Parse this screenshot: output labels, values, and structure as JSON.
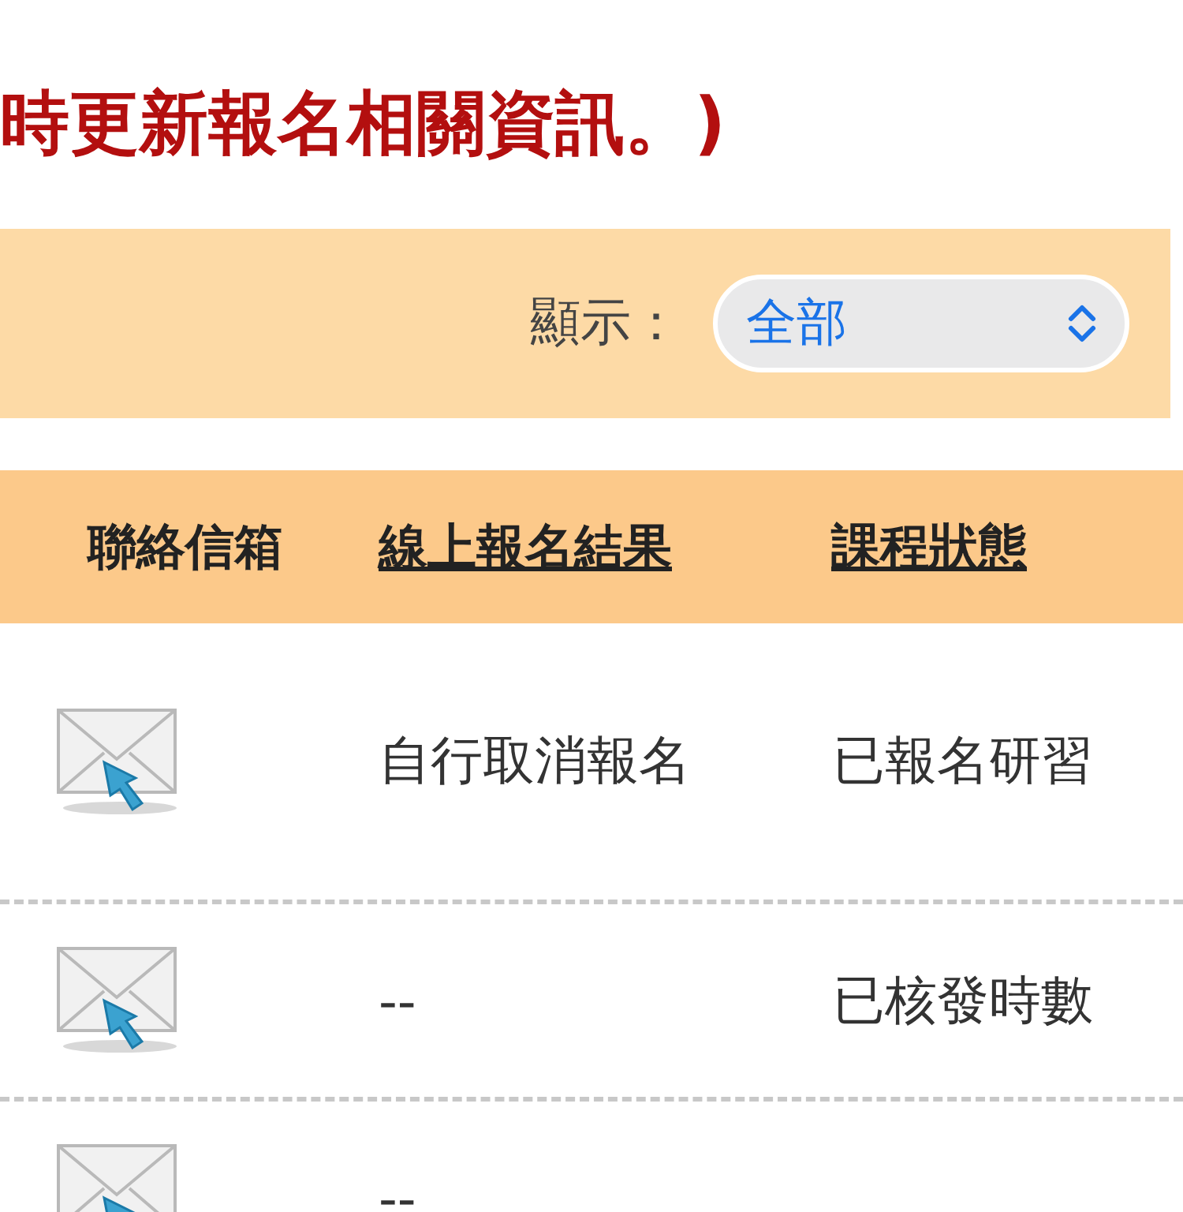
{
  "notice": "時更新報名相關資訊。)",
  "filter": {
    "label": "顯示：",
    "value": "全部"
  },
  "table": {
    "columns": [
      {
        "label": "聯絡信箱",
        "link": false
      },
      {
        "label": "線上報名結果",
        "link": true
      },
      {
        "label": "課程狀態",
        "link": true
      }
    ],
    "rows": [
      {
        "result": "自行取消報名",
        "status": "已報名研習"
      },
      {
        "result": "--",
        "status": "已核發時數"
      },
      {
        "result": "--"
      }
    ]
  }
}
